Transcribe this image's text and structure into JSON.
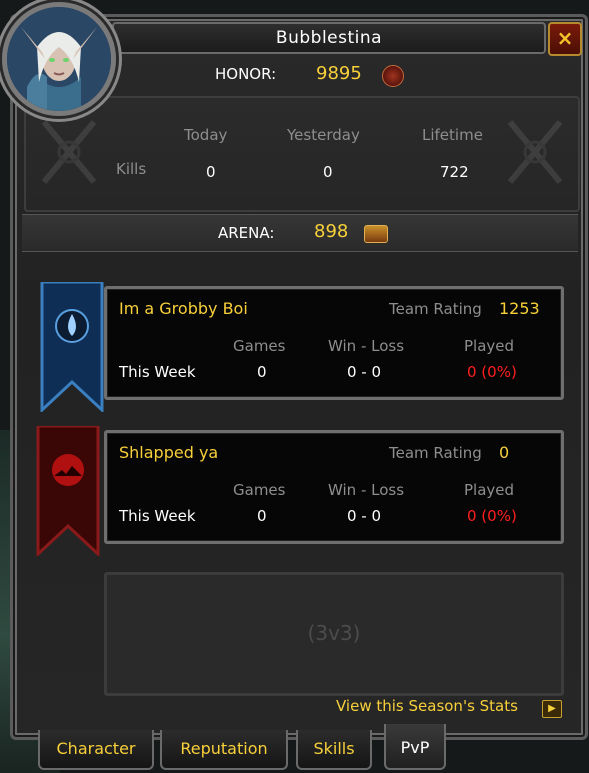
{
  "character": {
    "name": "Bubblestina"
  },
  "close_label": "×",
  "honor": {
    "label": "HONOR:",
    "value": "9895"
  },
  "kills": {
    "row_label": "Kills",
    "columns": [
      "Today",
      "Yesterday",
      "Lifetime"
    ],
    "values": [
      "0",
      "0",
      "722"
    ]
  },
  "arena": {
    "label": "ARENA:",
    "value": "898"
  },
  "teams": [
    {
      "name": "Im a Grobby Boi",
      "rating_label": "Team Rating",
      "rating": "1253",
      "headers": [
        "Games",
        "Win - Loss",
        "Played"
      ],
      "row_label": "This Week",
      "games": "0",
      "win_loss": "0 - 0",
      "played": "0 (0%)"
    },
    {
      "name": "Shlapped ya",
      "rating_label": "Team Rating",
      "rating": "0",
      "headers": [
        "Games",
        "Win - Loss",
        "Played"
      ],
      "row_label": "This Week",
      "games": "0",
      "win_loss": "0 - 0",
      "played": "0 (0%)"
    }
  ],
  "empty_slot": {
    "label": "(3v3)"
  },
  "season_link": "View this Season's Stats",
  "season_arrow": "▶",
  "tabs": [
    {
      "label": "Character"
    },
    {
      "label": "Reputation"
    },
    {
      "label": "Skills"
    },
    {
      "label": "PvP"
    }
  ],
  "colors": {
    "gold_text": "#f8d03a",
    "red_text": "#ff1e1e",
    "team1_banner": "#123a6a",
    "team2_banner": "#7a0f0f"
  },
  "icons": {
    "honor": "honor-medal-icon",
    "arena": "arena-chest-icon",
    "team1_emblem": "water-drop-emblem-icon",
    "team2_emblem": "sunset-emblem-icon"
  }
}
